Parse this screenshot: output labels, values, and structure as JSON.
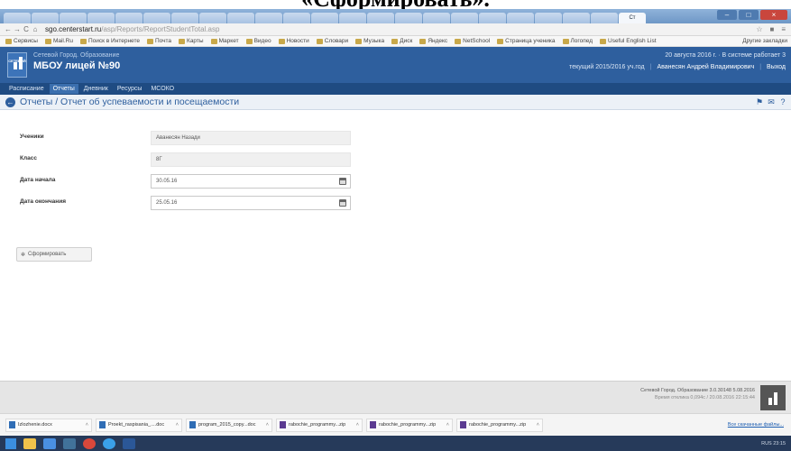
{
  "caption": {
    "text": "«Сформировать»."
  },
  "browser": {
    "tabs": [
      "",
      "",
      "",
      "",
      "",
      "",
      "",
      "",
      "",
      "",
      "",
      "",
      "",
      "",
      "",
      "",
      "",
      "",
      "",
      "",
      "",
      "",
      "Ст"
    ],
    "url_host": "sgo.centerstart.ru",
    "url_path": "/asp/Reports/ReportStudentTotal.asp",
    "bookmarks": [
      "Сервисы",
      "Mail.Ru",
      "Поиск в Интернете",
      "Почта",
      "Карты",
      "Маркет",
      "Видео",
      "Новости",
      "Словари",
      "Музыка",
      "Диск",
      "Яндекс",
      "NetSchool",
      "Страница ученика",
      "Логопед",
      "Useful English List"
    ],
    "other_bookmarks": "Другие закладки"
  },
  "app": {
    "logo_text": "СЕТЕВОЙ",
    "brand_top": "Сетевой Город. Образование",
    "school": "МБОУ лицей №90",
    "date_line": "20 августа 2016 г. · В системе работает 3",
    "year_line": "текущий 2015/2016 уч.год",
    "user": "Аванесян Андрей Владимирович",
    "logout": "Выход"
  },
  "menu": {
    "items": [
      "Расписание",
      "Отчеты",
      "Дневник",
      "Ресурсы",
      "МСОКО"
    ],
    "active_index": 1
  },
  "page": {
    "breadcrumb": "Отчеты / Отчет об успеваемости и посещаемости"
  },
  "form": {
    "student_label": "Ученики",
    "student_value": "Аванесян Назади",
    "class_label": "Класс",
    "class_value": "8Г",
    "start_label": "Дата начала",
    "start_value": "30.05.16",
    "end_label": "Дата окончания",
    "end_value": "25.05.16",
    "generate_label": "Сформировать"
  },
  "footer": {
    "line1": "Сетевой Город. Образование 3.0.30148 5.08.2016",
    "line2": "Время отклика 0,094с / 20.08.2016 22:15:44"
  },
  "downloads": {
    "files": [
      "Izlozhenie.docx",
      "Proekt_raspisania_....doc",
      "program_2015_copy...doc",
      "rabochie_programmy...zip",
      "rabochie_programmy...zip",
      "rabochie_programmy...zip"
    ],
    "file_types": [
      "doc",
      "doc",
      "doc",
      "zip",
      "zip",
      "zip"
    ],
    "show_all": "Все скачанные файлы..."
  },
  "taskbar": {
    "tray_text": "RUS  23:15"
  }
}
